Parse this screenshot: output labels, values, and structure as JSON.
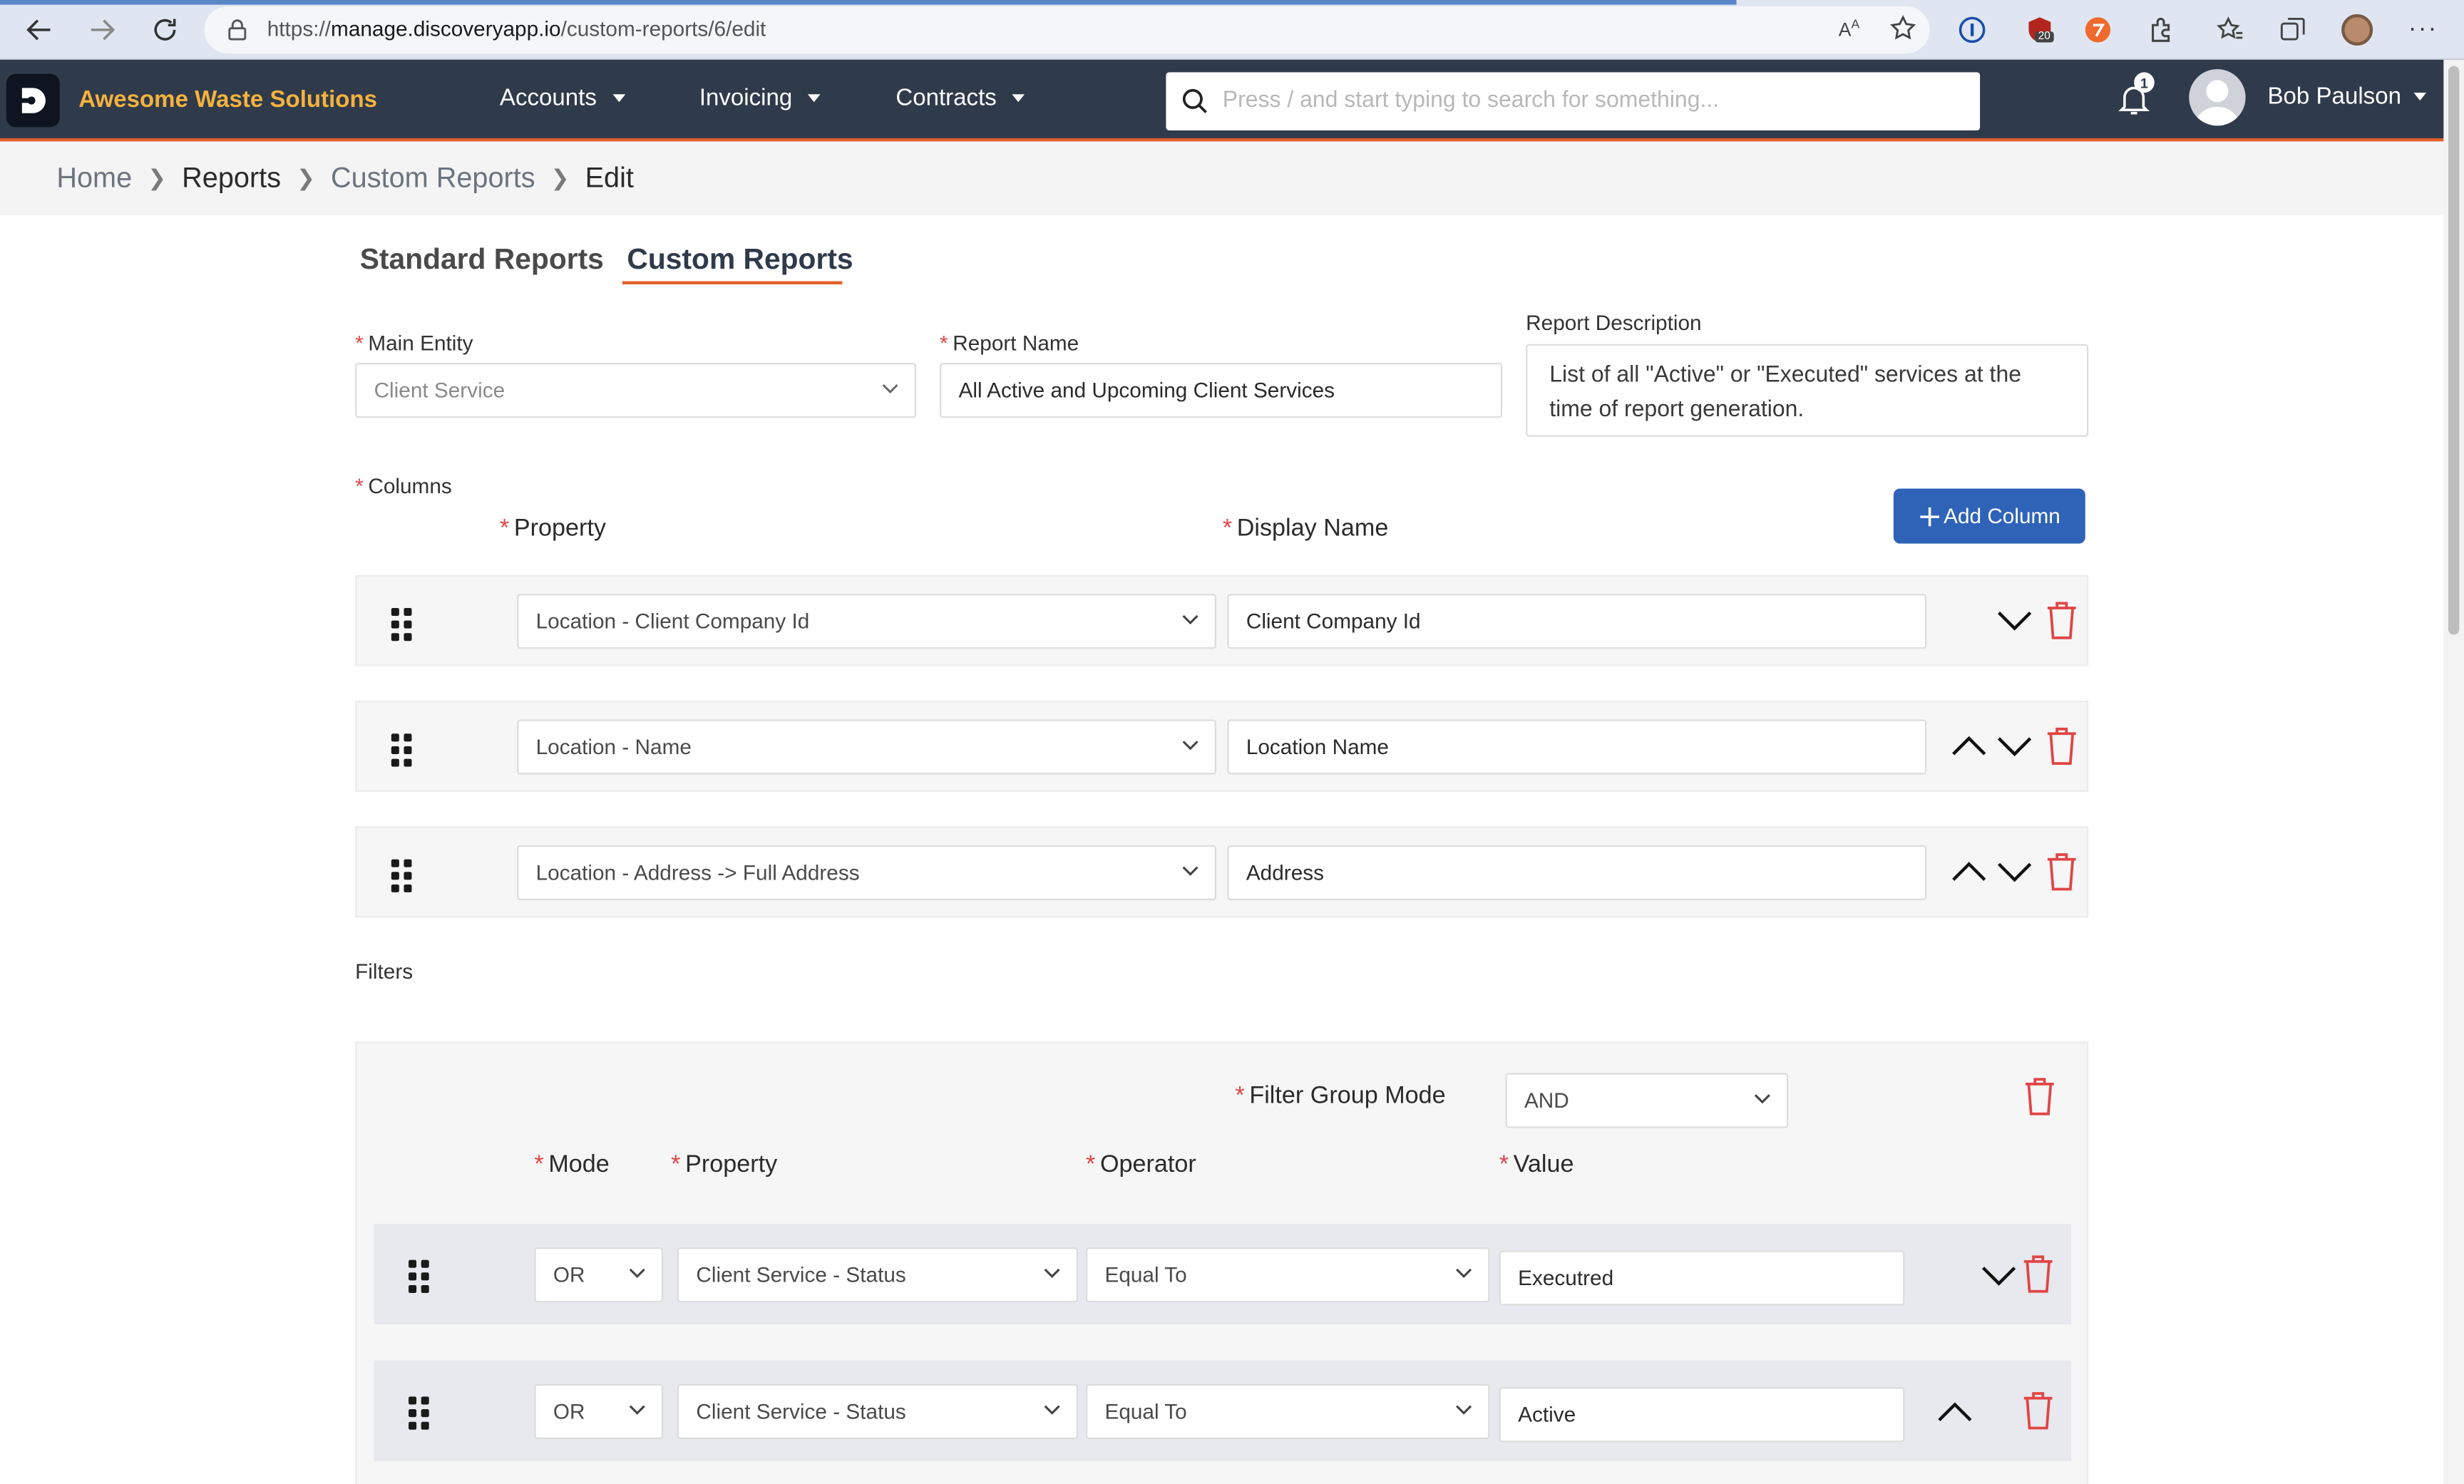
{
  "browser": {
    "url_prefix": "https://",
    "url_host": "manage.discoveryapp.io",
    "url_path": "/custom-reports/6/edit",
    "extension_badge": "20"
  },
  "header": {
    "brand": "Awesome Waste Solutions",
    "nav": [
      {
        "label": "Accounts"
      },
      {
        "label": "Invoicing"
      },
      {
        "label": "Contracts"
      }
    ],
    "search_placeholder": "Press / and start typing to search for something...",
    "notification_count": "1",
    "user_name": "Bob Paulson"
  },
  "breadcrumb": [
    "Home",
    "Reports",
    "Custom Reports",
    "Edit"
  ],
  "tabs": [
    {
      "label": "Standard Reports",
      "active": false
    },
    {
      "label": "Custom Reports",
      "active": true
    }
  ],
  "form": {
    "main_entity_label": "Main Entity",
    "main_entity_value": "Client Service",
    "report_name_label": "Report Name",
    "report_name_value": "All Active and Upcoming Client Services",
    "report_description_label": "Report Description",
    "report_description_value": "List of all \"Active\" or \"Executed\" services at the time of report generation.",
    "columns_label": "Columns",
    "property_header": "Property",
    "display_name_header": "Display Name",
    "add_column_label": "Add Column"
  },
  "columns": [
    {
      "property": "Location - Client Company Id",
      "display_name": "Client Company Id"
    },
    {
      "property": "Location - Name",
      "display_name": "Location Name"
    },
    {
      "property": "Location - Address -> Full Address",
      "display_name": "Address"
    }
  ],
  "filters": {
    "label": "Filters",
    "group_mode_label": "Filter Group Mode",
    "group_mode_value": "AND",
    "headers": {
      "mode": "Mode",
      "property": "Property",
      "operator": "Operator",
      "value": "Value"
    },
    "rows": [
      {
        "mode": "OR",
        "property": "Client Service - Status",
        "operator": "Equal To",
        "value": "Executred"
      },
      {
        "mode": "OR",
        "property": "Client Service - Status",
        "operator": "Equal To",
        "value": "Active"
      }
    ]
  },
  "colors": {
    "header_bg": "#2f3a4b",
    "brand": "#f4b23e",
    "accent": "#e35f2a",
    "primary_button": "#2e63b8",
    "delete": "#e04545"
  }
}
